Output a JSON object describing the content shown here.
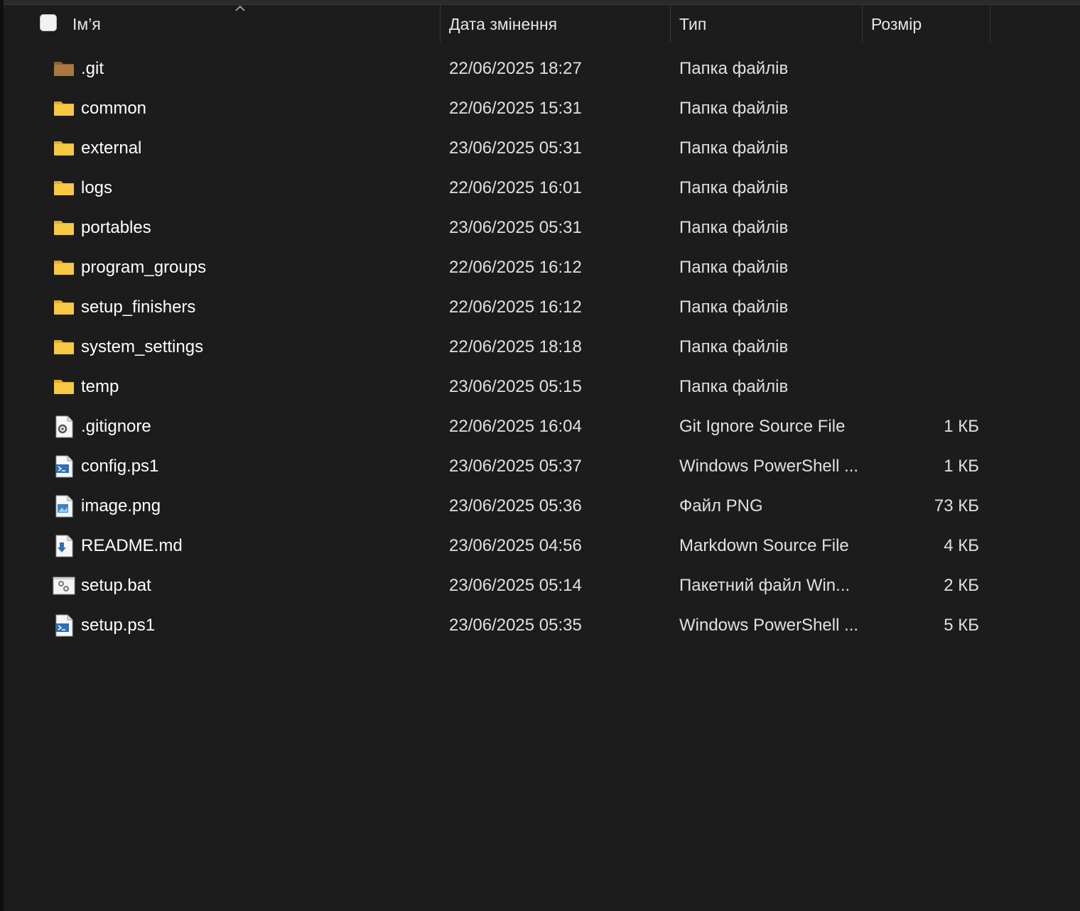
{
  "header": {
    "columns": [
      {
        "label": "Ім’я"
      },
      {
        "label": "Дата змінення"
      },
      {
        "label": "Тип"
      },
      {
        "label": "Розмір"
      }
    ]
  },
  "colors": {
    "background": "#1c1c1c",
    "folder": "#f6c844",
    "git_folder": "#a9793f",
    "text": "#ffffff"
  },
  "rows": [
    {
      "name": ".git",
      "date": "22/06/2025 18:27",
      "type": "Папка файлів",
      "size": "",
      "icon": "git-folder-icon"
    },
    {
      "name": "common",
      "date": "22/06/2025 15:31",
      "type": "Папка файлів",
      "size": "",
      "icon": "folder-icon"
    },
    {
      "name": "external",
      "date": "23/06/2025 05:31",
      "type": "Папка файлів",
      "size": "",
      "icon": "folder-icon"
    },
    {
      "name": "logs",
      "date": "22/06/2025 16:01",
      "type": "Папка файлів",
      "size": "",
      "icon": "folder-icon"
    },
    {
      "name": "portables",
      "date": "23/06/2025 05:31",
      "type": "Папка файлів",
      "size": "",
      "icon": "folder-icon"
    },
    {
      "name": "program_groups",
      "date": "22/06/2025 16:12",
      "type": "Папка файлів",
      "size": "",
      "icon": "folder-icon"
    },
    {
      "name": "setup_finishers",
      "date": "22/06/2025 16:12",
      "type": "Папка файлів",
      "size": "",
      "icon": "folder-icon"
    },
    {
      "name": "system_settings",
      "date": "22/06/2025 18:18",
      "type": "Папка файлів",
      "size": "",
      "icon": "folder-icon"
    },
    {
      "name": "temp",
      "date": "23/06/2025 05:15",
      "type": "Папка файлів",
      "size": "",
      "icon": "folder-icon"
    },
    {
      "name": ".gitignore",
      "date": "22/06/2025 16:04",
      "type": "Git Ignore Source File",
      "size": "1 КБ",
      "icon": "settings-file-icon"
    },
    {
      "name": "config.ps1",
      "date": "23/06/2025 05:37",
      "type": "Windows PowerShell ...",
      "size": "1 КБ",
      "icon": "powershell-file-icon"
    },
    {
      "name": "image.png",
      "date": "23/06/2025 05:36",
      "type": "Файл PNG",
      "size": "73 КБ",
      "icon": "image-file-icon"
    },
    {
      "name": "README.md",
      "date": "23/06/2025 04:56",
      "type": "Markdown Source File",
      "size": "4 КБ",
      "icon": "markdown-file-icon"
    },
    {
      "name": "setup.bat",
      "date": "23/06/2025 05:14",
      "type": "Пакетний файл Win...",
      "size": "2 КБ",
      "icon": "batch-file-icon"
    },
    {
      "name": "setup.ps1",
      "date": "23/06/2025 05:35",
      "type": "Windows PowerShell ...",
      "size": "5 КБ",
      "icon": "powershell-file-icon"
    }
  ]
}
